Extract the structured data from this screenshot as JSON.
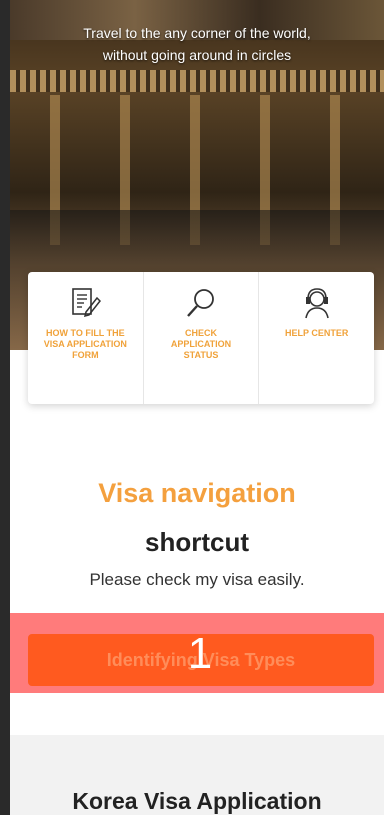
{
  "hero": {
    "tagline_line1": "Travel to the any corner of the world,",
    "tagline_line2": "without going around in circles"
  },
  "quick_menu": {
    "items": [
      {
        "label": "HOW TO FILL THE VISA APPLICATION FORM",
        "icon": "form-edit-icon"
      },
      {
        "label": "CHECK APPLICATION STATUS",
        "icon": "magnifier-icon"
      },
      {
        "label": "HELP CENTER",
        "icon": "headset-agent-icon"
      }
    ]
  },
  "visa_nav": {
    "title_line1": "Visa navigation",
    "title_line2": "shortcut",
    "subtitle": "Please check my visa easily.",
    "button_label": "Identifying Visa Types",
    "marker": "1"
  },
  "next_section": {
    "title": "Korea Visa Application"
  },
  "colors": {
    "accent_orange": "#f4a03e",
    "button_orange": "#ff5a1f",
    "highlight": "#ff6464"
  }
}
